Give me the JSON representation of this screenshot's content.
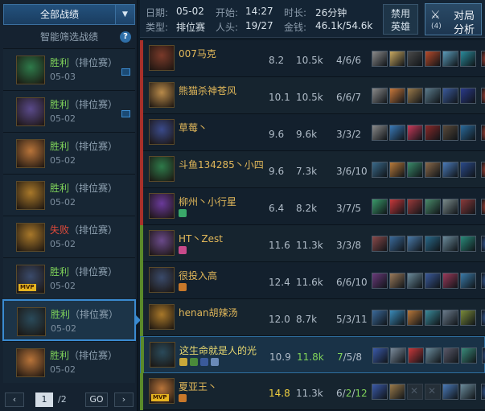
{
  "sidebar": {
    "all_label": "全部战绩",
    "smart_filter_label": "智能筛选战绩",
    "help_label": "?",
    "matches": [
      {
        "result": "胜利",
        "win": true,
        "mode": "（排位赛）",
        "date": "05-03",
        "hero_color": "#2e7a4a",
        "mvp": false,
        "has_pic": true
      },
      {
        "result": "胜利",
        "win": true,
        "mode": "（排位赛）",
        "date": "05-02",
        "hero_color": "#5a4a8a",
        "mvp": false,
        "has_pic": true
      },
      {
        "result": "胜利",
        "win": true,
        "mode": "（排位赛）",
        "date": "05-02",
        "hero_color": "#b8743a",
        "mvp": false,
        "has_pic": false
      },
      {
        "result": "胜利",
        "win": true,
        "mode": "（排位赛）",
        "date": "05-02",
        "hero_color": "#a8782a",
        "mvp": false,
        "has_pic": false
      },
      {
        "result": "失败",
        "win": false,
        "mode": "（排位赛）",
        "date": "05-02",
        "hero_color": "#a8782a",
        "mvp": false,
        "has_pic": false
      },
      {
        "result": "胜利",
        "win": true,
        "mode": "（排位赛）",
        "date": "05-02",
        "hero_color": "#3a4a6a",
        "mvp": true,
        "mvp_label": "MVP",
        "has_pic": false
      },
      {
        "result": "胜利",
        "win": true,
        "mode": "（排位赛）",
        "date": "05-02",
        "hero_color": "#2a4a5a",
        "mvp": false,
        "has_pic": false,
        "selected": true
      },
      {
        "result": "胜利",
        "win": true,
        "mode": "（排位赛）",
        "date": "05-02",
        "hero_color": "#b8743a",
        "mvp": false,
        "has_pic": false
      }
    ],
    "pager": {
      "prev": "‹",
      "page": "1",
      "total": "/2",
      "go": "GO",
      "next": "›"
    }
  },
  "header": {
    "date_label": "日期:",
    "date": "05-02",
    "start_label": "开始:",
    "start": "14:27",
    "duration_label": "时长:",
    "duration": "26分钟",
    "type_label": "类型:",
    "type": "排位赛",
    "kills_label": "人头:",
    "kills": "19/27",
    "gold_label": "金钱:",
    "gold": "46.1k/54.6k",
    "fav_line1": "禁用",
    "fav_line2": "英雄",
    "analysis_count": "(4)",
    "analysis_line1": "对局",
    "analysis_line2": "分析"
  },
  "players": [
    {
      "name": "007马克",
      "score": "8.2",
      "gold": "10.5k",
      "kda": "4/6/6",
      "team_color": "#a8302a",
      "hero_color": "#7a3a2a",
      "badges": [],
      "items": [
        "#8a8a8a",
        "#c8a860",
        "#4a4a4a",
        "#b84a2a",
        "#5a9ab8",
        "#2a8a9a"
      ],
      "trinket": "#c84a3a"
    },
    {
      "name": "熊猫杀神苍风",
      "score": "10.1",
      "gold": "10.5k",
      "kda": "6/6/7",
      "team_color": "#a8302a",
      "hero_color": "#b88a4a",
      "badges": [],
      "items": [
        "#8a8a8a",
        "#c8783a",
        "#9a7a4a",
        "#5a7a8a",
        "#3a5a9a",
        "#2a3a8a"
      ],
      "trinket": "#c84a3a"
    },
    {
      "name": "草莓丶",
      "score": "9.6",
      "gold": "9.6k",
      "kda": "3/3/2",
      "team_color": "#a8302a",
      "hero_color": "#3a4a8a",
      "badges": [],
      "items": [
        "#8a8a8a",
        "#3a7ab8",
        "#c83a5a",
        "#8a2a2a",
        "#5a4a3a",
        "#2a6a9a"
      ],
      "trinket": "#c84a3a"
    },
    {
      "name": "斗鱼134285丶小四",
      "score": "9.6",
      "gold": "7.3k",
      "kda": "3/6/10",
      "team_color": "#a8302a",
      "hero_color": "#2e7a4a",
      "badges": [],
      "items": [
        "#3a6a8a",
        "#b87a3a",
        "#3a8a6a",
        "#8a6a4a",
        "#4a7ab8",
        "#2a4a8a"
      ],
      "trinket": "#c84a3a"
    },
    {
      "name": "柳州丶小行星",
      "score": "6.4",
      "gold": "8.2k",
      "kda": "3/7/5",
      "team_color": "#a8302a",
      "hero_color": "#6a3a9a",
      "badges": [
        "#3aa86a"
      ],
      "items": [
        "#3a9a6a",
        "#c8383a",
        "#9a3a3a",
        "#4a8a6a",
        "#7a8a8a",
        "#8a3a3a"
      ],
      "trinket": "#c84a3a"
    },
    {
      "name": "HT丶Zest",
      "score": "11.6",
      "gold": "11.3k",
      "kda": "3/3/8",
      "team_color": "#5a8a2a",
      "hero_color": "#6a4a8a",
      "badges": [
        "#c84a8a"
      ],
      "items": [
        "#8a4a4a",
        "#3a6a9a",
        "#4a7aa8",
        "#2a6a8a",
        "#6a8a9a",
        "#2a8a7a"
      ],
      "trinket": "#3a6ab8"
    },
    {
      "name": "很投入高",
      "score": "12.4",
      "gold": "11.6k",
      "kda": "6/6/10",
      "team_color": "#5a8a2a",
      "hero_color": "#3a4a6a",
      "badges": [
        "#c8782a"
      ],
      "items": [
        "#6a3a7a",
        "#9a7a5a",
        "#6a8a9a",
        "#3a5a9a",
        "#9a3a5a",
        "#3a7aa8"
      ],
      "trinket": "#3a6ab8"
    },
    {
      "name": "henan胡辣汤",
      "score": "12.0",
      "gold": "8.7k",
      "kda": "5/3/11",
      "team_color": "#5a8a2a",
      "hero_color": "#a8782a",
      "badges": [],
      "items": [
        "#3a6a9a",
        "#3a8ab8",
        "#b8783a",
        "#3a8a9a",
        "#6a7a8a",
        "#7a8a3a"
      ],
      "trinket": "#3a6ab8"
    },
    {
      "name": "这生命就是人的光",
      "score": "10.9",
      "gold": "11.8k",
      "kda_parts": [
        "7",
        "/5/8"
      ],
      "me": true,
      "team_color": "#5a8a2a",
      "hero_color": "#2a4a5a",
      "badges": [
        "#c8a83a",
        "#4a8a3a",
        "#3a5a9a",
        "#6a8ab8"
      ],
      "items": [
        "#3a5aa8",
        "#7a8a9a",
        "#c8383a",
        "#6a8a9a",
        "#5a5a6a",
        "#3a8a7a"
      ],
      "trinket": "#3a6ab8"
    },
    {
      "name": "夏亚王丶",
      "score": "14.8",
      "gold": "11.3k",
      "kda_parts": [
        "6/",
        "2",
        "/",
        "12"
      ],
      "team_color": "#5a8a2a",
      "hero_color": "#b8743a",
      "mvp": true,
      "mvp_label": "MVP",
      "badges": [
        "#c8782a"
      ],
      "items": [
        "#3a5aa8",
        "#9a7a4a",
        "empty",
        "empty",
        "#4a7ab8",
        "#6a8a9a"
      ],
      "trinket": "#3a6ab8"
    }
  ]
}
